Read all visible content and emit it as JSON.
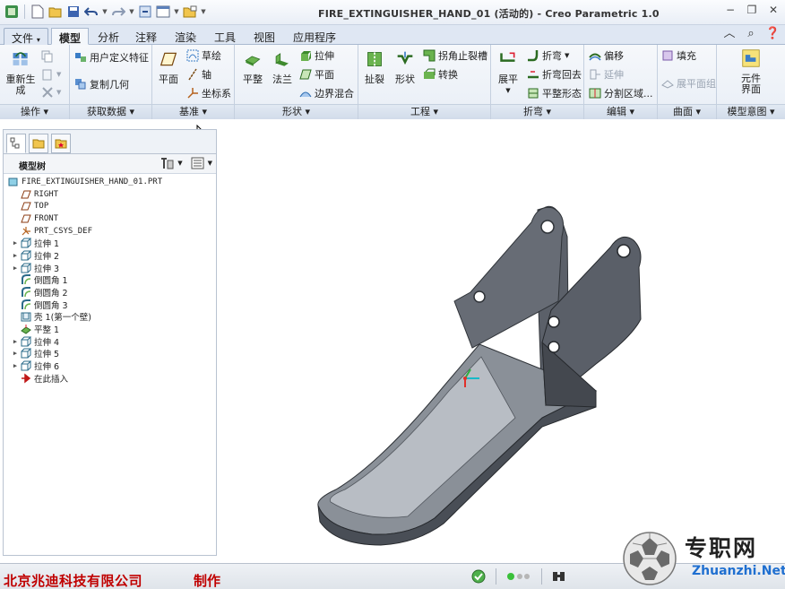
{
  "window": {
    "title": "FIRE_EXTINGUISHER_HAND_01 (活动的) - Creo Parametric 1.0"
  },
  "tabs": [
    {
      "label": "文件",
      "dropdown": "▾"
    },
    {
      "label": "模型"
    },
    {
      "label": "分析"
    },
    {
      "label": "注释"
    },
    {
      "label": "渲染"
    },
    {
      "label": "工具"
    },
    {
      "label": "视图"
    },
    {
      "label": "应用程序"
    }
  ],
  "active_tab": "模型",
  "ribbon": {
    "operations": {
      "regenerate": "重新生成",
      "footer": "操作"
    },
    "get_data": {
      "udf": "用户定义特征",
      "copy_geom": "复制几何",
      "footer": "获取数据"
    },
    "datum": {
      "plane": "平面",
      "sketch": "草绘",
      "axis": "轴",
      "csys": "坐标系",
      "footer": "基准"
    },
    "shapes": {
      "flat": "平整",
      "flange": "法兰",
      "extrude": "拉伸",
      "plane": "平面",
      "boundary_blend": "边界混合",
      "footer": "形状"
    },
    "engineering": {
      "rip": "扯裂",
      "form": "形状",
      "corner_relief": "拐角止裂槽",
      "convert": "转换",
      "footer": "工程"
    },
    "bends": {
      "unbend": "展平",
      "bend": "折弯",
      "bend_back": "折弯回去",
      "flat_state": "平整形态",
      "footer": "折弯"
    },
    "editing": {
      "offset": "偏移",
      "extend": "延伸",
      "split_area": "分割区域...",
      "footer": "编辑"
    },
    "surfaces": {
      "fill": "填充",
      "flatten_quilt": "展平面组",
      "footer": "曲面"
    },
    "model_intent": {
      "component_interface": "元件界面",
      "footer": "模型意图"
    }
  },
  "model_tree": {
    "header": "模型树",
    "items": [
      {
        "label": "FIRE_EXTINGUISHER_HAND_01.PRT",
        "icon": "part-icon",
        "expandable": false,
        "mono": true
      },
      {
        "label": "RIGHT",
        "icon": "datum-plane-icon",
        "expandable": false,
        "mono": true
      },
      {
        "label": "TOP",
        "icon": "datum-plane-icon",
        "expandable": false,
        "mono": true
      },
      {
        "label": "FRONT",
        "icon": "datum-plane-icon",
        "expandable": false,
        "mono": true
      },
      {
        "label": "PRT_CSYS_DEF",
        "icon": "csys-icon",
        "expandable": false,
        "mono": true
      },
      {
        "label": "拉伸 1",
        "icon": "extrude-icon",
        "expandable": true
      },
      {
        "label": "拉伸 2",
        "icon": "extrude-icon",
        "expandable": true
      },
      {
        "label": "拉伸 3",
        "icon": "extrude-icon",
        "expandable": true
      },
      {
        "label": "倒圆角 1",
        "icon": "round-icon",
        "expandable": false
      },
      {
        "label": "倒圆角 2",
        "icon": "round-icon",
        "expandable": false
      },
      {
        "label": "倒圆角 3",
        "icon": "round-icon",
        "expandable": false
      },
      {
        "label": "壳 1(第一个壁)",
        "icon": "shell-icon",
        "expandable": false
      },
      {
        "label": "平整 1",
        "icon": "flat-wall-icon",
        "expandable": false
      },
      {
        "label": "拉伸 4",
        "icon": "extrude-icon",
        "expandable": true
      },
      {
        "label": "拉伸 5",
        "icon": "extrude-icon",
        "expandable": true
      },
      {
        "label": "拉伸 6",
        "icon": "extrude-icon",
        "expandable": true
      },
      {
        "label": "在此插入",
        "icon": "insert-here-icon",
        "expandable": false
      }
    ]
  },
  "status": {
    "company": "北京兆迪科技有限公司",
    "made": "制作"
  },
  "watermark": {
    "name": "专职网",
    "url": "Zhuanzhi.Net"
  },
  "colors": {
    "accent": "#2f6db5",
    "part": "#4a4f57",
    "company_text": "#c00000",
    "watermark_url": "#1f6fd0"
  }
}
